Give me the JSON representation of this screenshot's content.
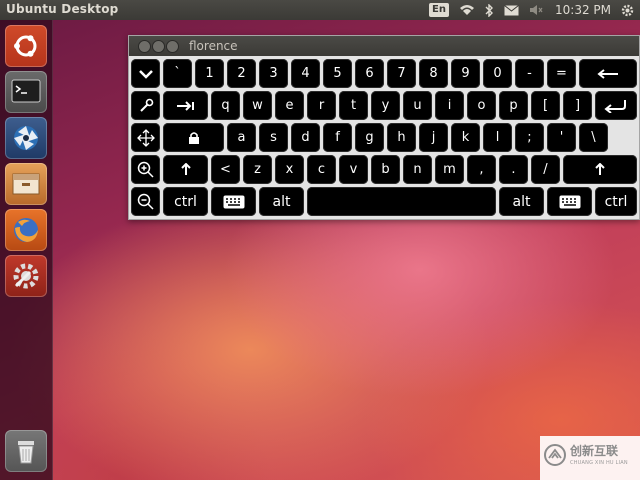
{
  "top_panel": {
    "title": "Ubuntu Desktop",
    "keyboard_indicator": "En",
    "clock": "10:32 PM",
    "icons": [
      "keyboard-layout-indicator",
      "wifi-icon",
      "bluetooth-icon",
      "mail-icon",
      "volume-icon",
      "gear-icon"
    ]
  },
  "launcher": {
    "items": [
      {
        "name": "dash-home",
        "icon": "ubuntu-logo-icon"
      },
      {
        "name": "terminal",
        "icon": "terminal-icon"
      },
      {
        "name": "screenshot",
        "icon": "shutter-icon"
      },
      {
        "name": "files",
        "icon": "files-icon"
      },
      {
        "name": "firefox",
        "icon": "firefox-icon"
      },
      {
        "name": "system-settings",
        "icon": "settings-icon"
      },
      {
        "name": "trash",
        "icon": "trash-icon"
      }
    ]
  },
  "florence": {
    "title": "florence",
    "rows": [
      [
        "`",
        "1",
        "2",
        "3",
        "4",
        "5",
        "6",
        "7",
        "8",
        "9",
        "0",
        "-",
        "="
      ],
      [
        "q",
        "w",
        "e",
        "r",
        "t",
        "y",
        "u",
        "i",
        "o",
        "p",
        "[",
        "]"
      ],
      [
        "a",
        "s",
        "d",
        "f",
        "g",
        "h",
        "j",
        "k",
        "l",
        ";",
        "'",
        "\\"
      ],
      [
        "<",
        "z",
        "x",
        "c",
        "v",
        "b",
        "n",
        "m",
        ",",
        ".",
        "/"
      ]
    ],
    "modifiers": {
      "ctrl_left": "ctrl",
      "alt_left": "alt",
      "alt_right": "alt",
      "ctrl_right": "ctrl"
    }
  },
  "watermark": {
    "text": "创新互联",
    "subtext": "CHUANG XIN HU LIAN"
  },
  "colors": {
    "key_background": "#000000",
    "key_text": "#ffffff",
    "panel": "#3b3a36",
    "keyboard_frame": "#e4e4e4"
  }
}
